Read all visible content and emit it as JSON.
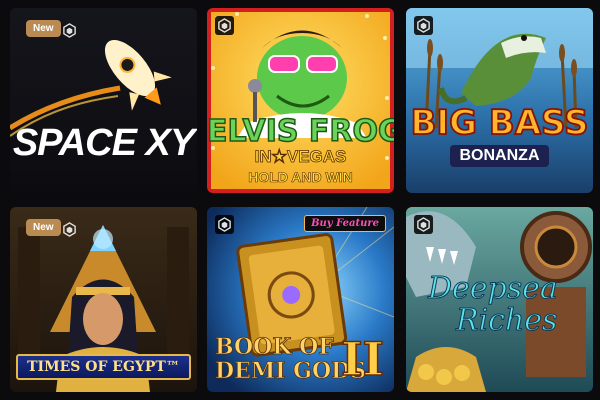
{
  "games": [
    {
      "id": "space-xy",
      "title": "SPACE XY",
      "badge": "New"
    },
    {
      "id": "elvis-frog",
      "title_line1": "ELVIS FROG",
      "title_line2": "IN★VEGAS",
      "title_line3": "HOLD AND WIN"
    },
    {
      "id": "big-bass",
      "title_line1": "BIG BASS",
      "title_line2": "BONANZA"
    },
    {
      "id": "times-of-egypt",
      "title": "TIMES OF EGYPT™",
      "badge": "New"
    },
    {
      "id": "book-of-demi-gods",
      "title_line1": "BOOK OF",
      "title_line2": "DEMI GODS",
      "numeral": "II",
      "ribbon": "Buy Feature"
    },
    {
      "id": "deepsea-riches",
      "title_line1": "Deepsea",
      "title_line2": "Riches"
    }
  ],
  "icons": {
    "provider": "hexagon-icon",
    "rocket": "rocket-icon"
  },
  "colors": {
    "background": "#0b0b0d",
    "badge": "#b98a52",
    "accent_ring": "#ff2a2a"
  }
}
